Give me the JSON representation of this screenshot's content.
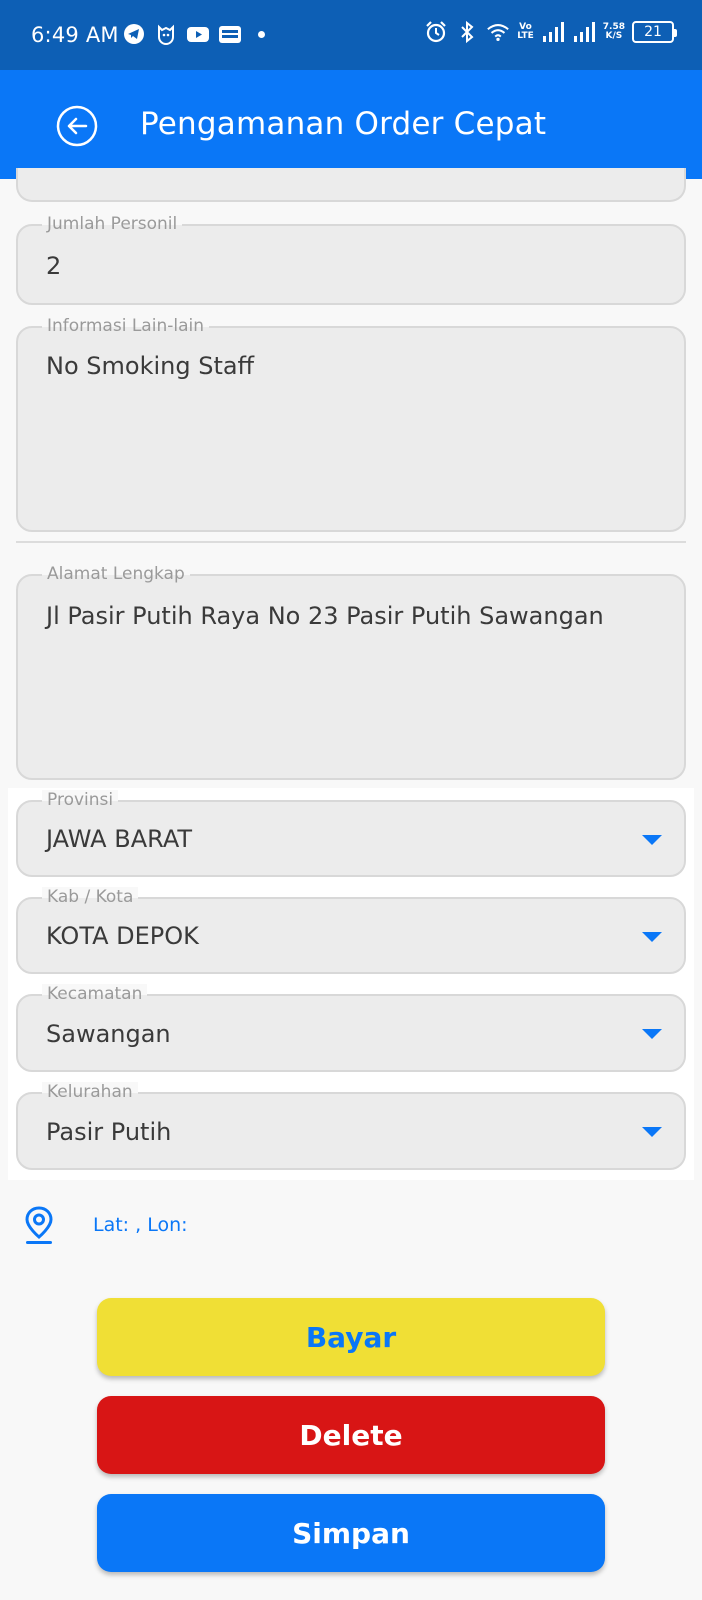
{
  "status_bar": {
    "time": "6:49 AM",
    "network_speed_value": "7.58",
    "network_speed_unit": "K/S",
    "volte_top": "Vo",
    "volte_bottom": "LTE",
    "battery": "21",
    "icons": [
      "telegram-icon",
      "mi-icon",
      "youtube-icon",
      "app-icon",
      "alarm-icon",
      "bluetooth-icon",
      "wifi-icon",
      "signal-icon",
      "signal-icon"
    ]
  },
  "appbar": {
    "title": "Pengamanan Order Cepat"
  },
  "form": {
    "jumlah_personil": {
      "label": "Jumlah Personil",
      "value": "2"
    },
    "informasi_lain": {
      "label": "Informasi Lain-lain",
      "value": "No Smoking Staff"
    },
    "alamat_lengkap": {
      "label": "Alamat Lengkap",
      "value": "Jl Pasir Putih Raya No 23 Pasir Putih Sawangan"
    },
    "provinsi": {
      "label": "Provinsi",
      "value": "JAWA BARAT"
    },
    "kab_kota": {
      "label": "Kab / Kota",
      "value": "KOTA DEPOK"
    },
    "kecamatan": {
      "label": "Kecamatan",
      "value": "Sawangan"
    },
    "kelurahan": {
      "label": "Kelurahan",
      "value": "Pasir Putih"
    }
  },
  "location": {
    "text": "Lat: , Lon:"
  },
  "buttons": {
    "bayar": "Bayar",
    "delete": "Delete",
    "simpan": "Simpan"
  },
  "colors": {
    "status_bar": "#0d5fb5",
    "appbar": "#0a77f7",
    "bayar": "#f0df35",
    "delete": "#d81515",
    "simpan": "#0a77f7"
  }
}
